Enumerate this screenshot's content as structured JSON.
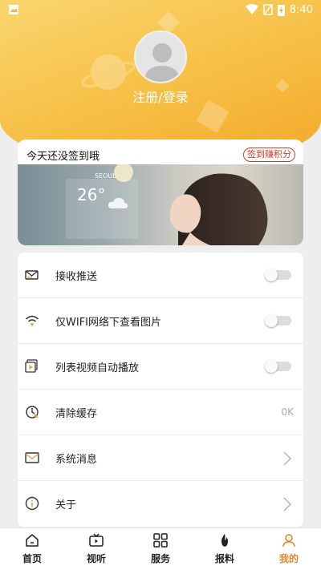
{
  "status_bar": {
    "time": "8:40"
  },
  "profile": {
    "login_label": "注册/登录"
  },
  "sign_in": {
    "title": "今天还没签到哦",
    "button_label": "签到赚积分"
  },
  "banner": {
    "weather_city": "SEOUL",
    "weather_temp": "26°"
  },
  "settings": [
    {
      "label": "接收推送",
      "icon": "push-icon",
      "control": "toggle",
      "on": false
    },
    {
      "label": "仅WIFI网络下查看图片",
      "icon": "wifi-icon",
      "control": "toggle",
      "on": false
    },
    {
      "label": "列表视频自动播放",
      "icon": "video-icon",
      "control": "toggle",
      "on": false
    },
    {
      "label": "清除缓存",
      "icon": "cache-icon",
      "control": "value",
      "value": "0K"
    },
    {
      "label": "系统消息",
      "icon": "mail-icon",
      "control": "chevron"
    },
    {
      "label": "关于",
      "icon": "info-icon",
      "control": "chevron"
    }
  ],
  "tabs": [
    {
      "label": "首页",
      "icon": "home-icon",
      "active": false
    },
    {
      "label": "视听",
      "icon": "tv-icon",
      "active": false
    },
    {
      "label": "服务",
      "icon": "grid-icon",
      "active": false
    },
    {
      "label": "报料",
      "icon": "flame-icon",
      "active": false
    },
    {
      "label": "我的",
      "icon": "user-icon",
      "active": true
    }
  ],
  "colors": {
    "accent": "#e8852a",
    "header": "#f7c24a",
    "sign_button": "#d23b2a"
  }
}
